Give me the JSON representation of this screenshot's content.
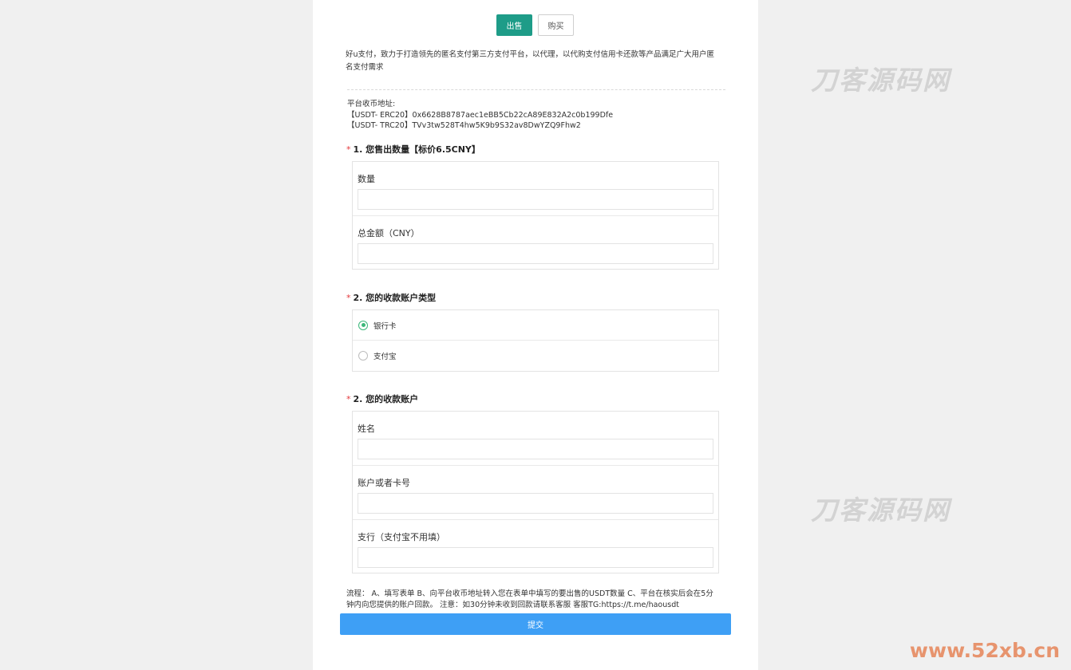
{
  "watermarks": {
    "brand_text": "刀客源码网",
    "url_text": "www.52xb.cn"
  },
  "tabs": [
    {
      "label": "出售",
      "active": true
    },
    {
      "label": "购买",
      "active": false
    }
  ],
  "intro": {
    "line1": "好u支付，致力于打造领先的匿名支付第三方支付平台，以代理，以代购支付信用卡还款等产品满足广大用户匿",
    "line2": "名支付需求"
  },
  "address": {
    "title": "平台收币地址:",
    "erc20": "【USDT- ERC20】0x6628B8787aec1eBB5Cb22cA89E832A2c0b199Dfe",
    "trc20": "【USDT- TRC20】TVv3tw528T4hw5K9b9S32av8DwYZQ9Fhw2"
  },
  "section1": {
    "required_mark": "*",
    "title": "1. 您售出数量【标价6.5CNY】",
    "fields": [
      {
        "label": "数量",
        "value": ""
      },
      {
        "label": "总金额（CNY）",
        "value": ""
      }
    ]
  },
  "section2": {
    "required_mark": "*",
    "title": "2. 您的收款账户类型",
    "options": [
      {
        "label": "银行卡",
        "checked": true
      },
      {
        "label": "支付宝",
        "checked": false
      }
    ]
  },
  "section3": {
    "required_mark": "*",
    "title": "2. 您的收款账户",
    "fields": [
      {
        "label": "姓名",
        "value": ""
      },
      {
        "label": "账户或者卡号",
        "value": ""
      },
      {
        "label": "支行（支付宝不用填）",
        "value": ""
      }
    ]
  },
  "note": {
    "line1": "流程： A、填写表单 B、向平台收币地址转入您在表单中填写的要出售的USDT数量 C、平台在核实后会在5分",
    "line2": "钟内向您提供的账户回款。 注意：如30分钟未收到回款请联系客服 客服TG:https://t.me/haousdt"
  },
  "submit_label": "提交",
  "colors": {
    "accent_green": "#1e9c88",
    "submit_blue": "#3e9ff5",
    "required_red": "#e4393c",
    "radio_green": "#3bb87a"
  }
}
